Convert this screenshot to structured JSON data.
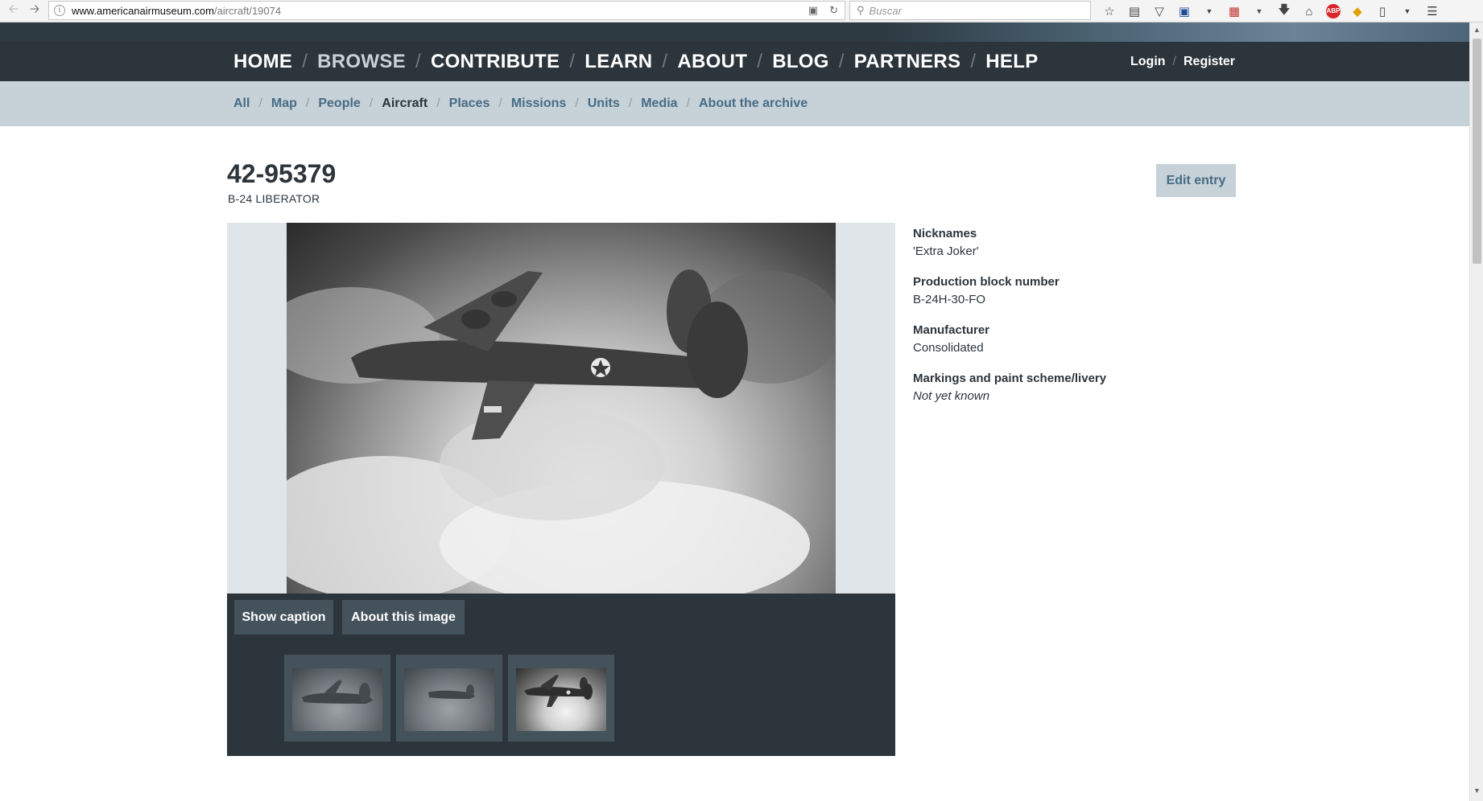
{
  "browser": {
    "url_host": "www.americanairmuseum.com",
    "url_path": "/aircraft/19074",
    "search_placeholder": "Buscar"
  },
  "site": {
    "main_nav": [
      "HOME",
      "BROWSE",
      "CONTRIBUTE",
      "LEARN",
      "ABOUT",
      "BLOG",
      "PARTNERS",
      "HELP"
    ],
    "active_main_nav": "BROWSE",
    "account": {
      "login": "Login",
      "register": "Register"
    },
    "sub_nav": [
      "All",
      "Map",
      "People",
      "Aircraft",
      "Places",
      "Missions",
      "Units",
      "Media",
      "About the archive"
    ],
    "current_sub_nav": "Aircraft"
  },
  "entry": {
    "title": "42-95379",
    "subtitle": "B-24 LIBERATOR",
    "edit_label": "Edit entry"
  },
  "gallery": {
    "show_caption_label": "Show caption",
    "about_image_label": "About this image",
    "thumbnail_count": 3,
    "selected_thumbnail": 3
  },
  "details": [
    {
      "label": "Nicknames",
      "value": "'Extra Joker'"
    },
    {
      "label": "Production block number",
      "value": "B-24H-30-FO"
    },
    {
      "label": "Manufacturer",
      "value": "Consolidated"
    },
    {
      "label": "Markings and paint scheme/livery",
      "value": "Not yet known"
    }
  ],
  "colors": {
    "nav_bg": "#2c353b",
    "subnav_bg": "#c6d1d8",
    "link": "#476c85",
    "button_bg": "#44525b"
  },
  "icons": [
    "back-arrow-icon",
    "forward-arrow-icon",
    "info-icon",
    "reader-view-icon",
    "reload-icon",
    "search-icon",
    "bookmark-star-icon",
    "reading-list-icon",
    "pocket-icon",
    "save-icon",
    "pdf-icon",
    "download-icon",
    "home-icon",
    "adblock-icon",
    "extension-icon",
    "clipboard-icon",
    "menu-icon"
  ]
}
